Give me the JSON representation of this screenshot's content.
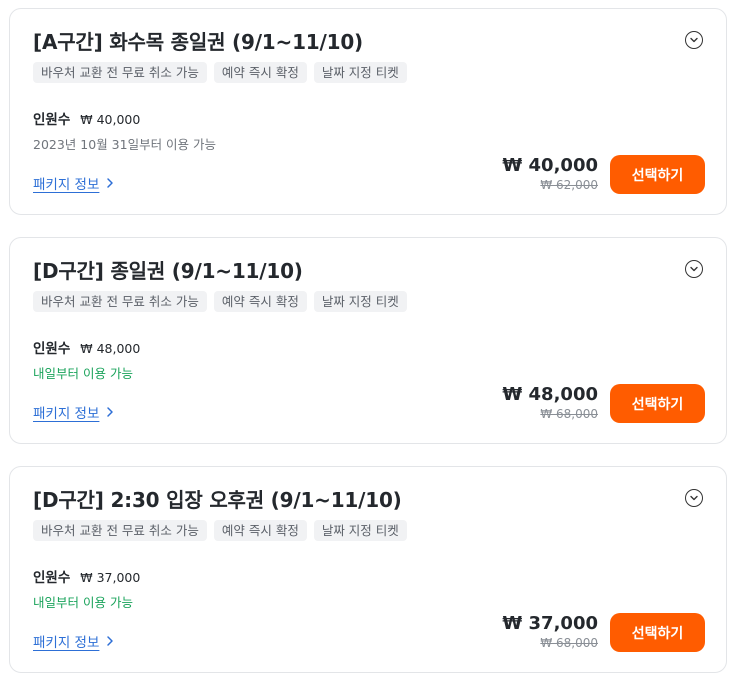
{
  "colors": {
    "accent": "#ff5c00",
    "link": "#2d6fd6",
    "available_green": "#1aa35b"
  },
  "icons": {
    "expand": "chevron-down-circle-icon",
    "package_info": "chevron-right-icon"
  },
  "products": [
    {
      "title": "[A구간] 화수목 종일권 (9/1~11/10)",
      "tags": [
        "바우처 교환 전 무료 취소 가능",
        "예약 즉시 확정",
        "날짜 지정 티켓"
      ],
      "quantity_label": "인원수",
      "quantity_price": "₩ 40,000",
      "availability": "2023년 10월 31일부터 이용 가능",
      "package_link": "패키지 정보",
      "price": "₩ 40,000",
      "original_price": "₩ 62,000",
      "select_label": "선택하기"
    },
    {
      "title": "[D구간] 종일권 (9/1~11/10)",
      "tags": [
        "바우처 교환 전 무료 취소 가능",
        "예약 즉시 확정",
        "날짜 지정 티켓"
      ],
      "quantity_label": "인원수",
      "quantity_price": "₩ 48,000",
      "availability": "내일부터 이용 가능",
      "package_link": "패키지 정보",
      "price": "₩ 48,000",
      "original_price": "₩ 68,000",
      "select_label": "선택하기"
    },
    {
      "title": "[D구간] 2:30 입장 오후권 (9/1~11/10)",
      "tags": [
        "바우처 교환 전 무료 취소 가능",
        "예약 즉시 확정",
        "날짜 지정 티켓"
      ],
      "quantity_label": "인원수",
      "quantity_price": "₩ 37,000",
      "availability": "내일부터 이용 가능",
      "package_link": "패키지 정보",
      "price": "₩ 37,000",
      "original_price": "₩ 68,000",
      "select_label": "선택하기"
    }
  ]
}
